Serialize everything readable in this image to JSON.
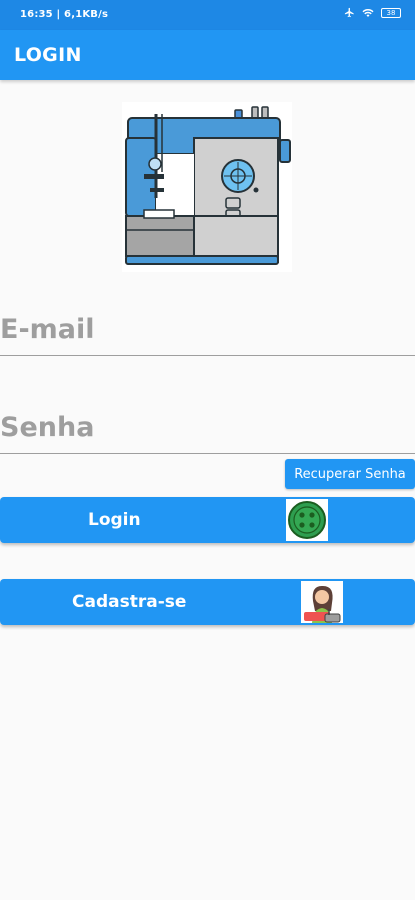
{
  "status_bar": {
    "left_text": "16:35 | 6,1KB/s",
    "battery": "38"
  },
  "app_bar": {
    "title": "LOGIN"
  },
  "logo": {
    "icon": "sewing-machine-icon"
  },
  "form": {
    "email_placeholder": "E-mail",
    "password_placeholder": "Senha",
    "recover_label": "Recuperar Senha",
    "login_label": "Login",
    "signup_label": "Cadastra-se"
  },
  "icons": {
    "login_button_icon": "green-button-icon",
    "signup_button_icon": "seamstress-avatar-icon"
  },
  "colors": {
    "primary": "#2196f3",
    "status_bar": "#1e88e5",
    "background": "#fafafa",
    "placeholder": "#9e9e9e"
  }
}
